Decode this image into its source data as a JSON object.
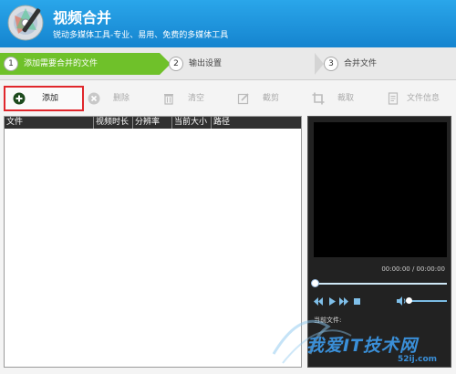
{
  "header": {
    "title": "视频合并",
    "subtitle": "锐动多媒体工具-专业、易用、免费的多媒体工具"
  },
  "steps": [
    {
      "num": "1",
      "label": "添加需要合并的文件",
      "active": true
    },
    {
      "num": "2",
      "label": "输出设置",
      "active": false
    },
    {
      "num": "3",
      "label": "合并文件",
      "active": false
    }
  ],
  "toolbar": {
    "add": "添加",
    "delete": "删除",
    "clear": "清空",
    "cut": "截剪",
    "crop": "裁取",
    "file_info": "文件信息"
  },
  "file_list": {
    "columns": [
      "文件",
      "视频时长",
      "分辨率",
      "当前大小",
      "路径"
    ]
  },
  "preview": {
    "time": "00:00:00 / 00:00:00",
    "current_file_label": "当前文件:"
  },
  "watermark": {
    "text": "我爱IT技术网",
    "site": "52ij.com"
  },
  "colors": {
    "header_blue": "#1e95de",
    "step_active_green": "#6fc12a",
    "add_border_red": "#e0262b"
  }
}
